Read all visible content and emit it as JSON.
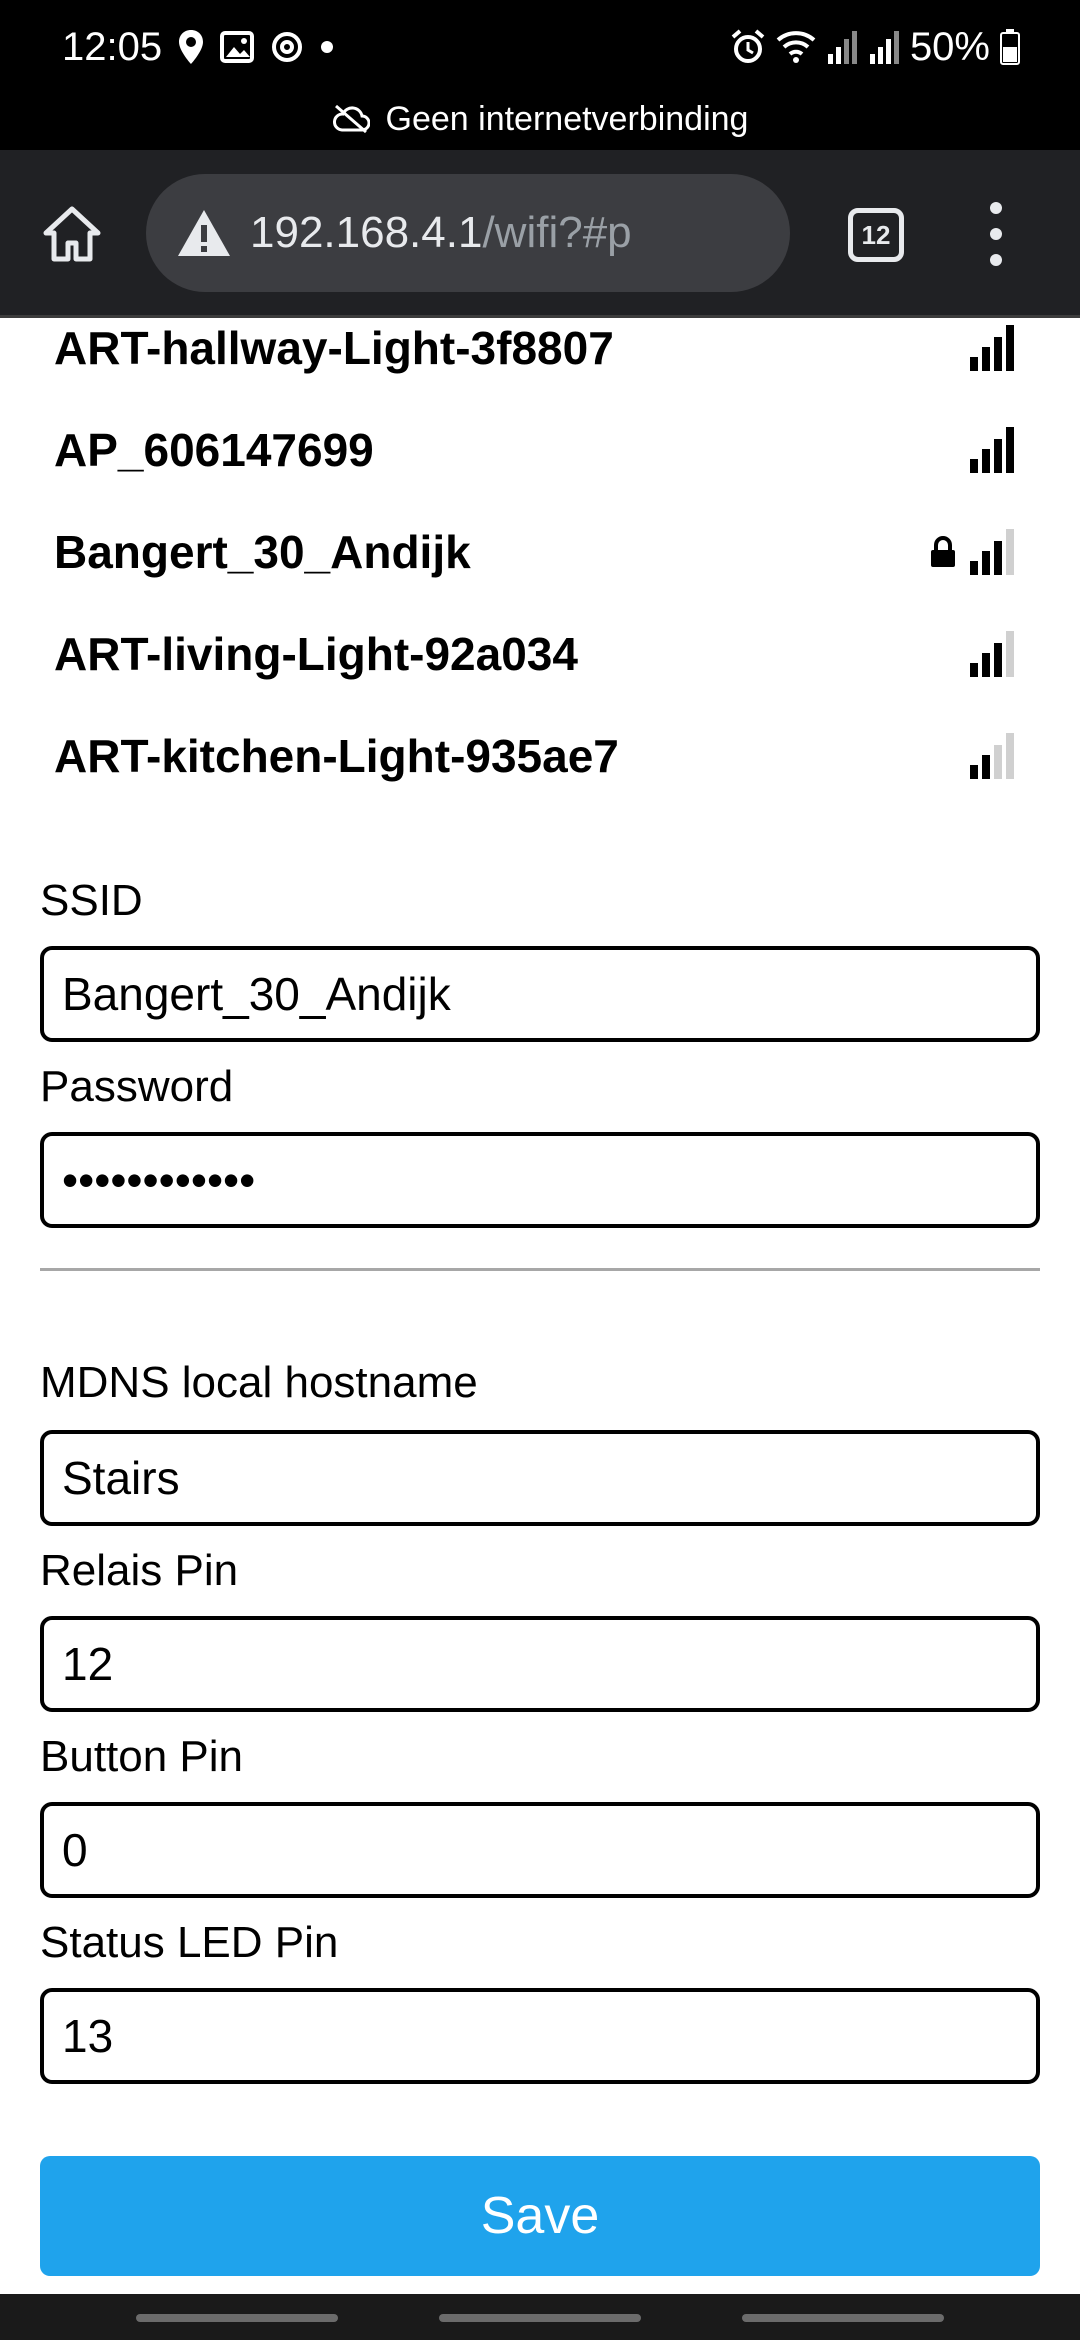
{
  "status_bar": {
    "time": "12:05",
    "battery_text": "50%",
    "no_connection_text": "Geen internetverbinding",
    "left_icons": [
      "location-icon",
      "gallery-icon",
      "sync-icon",
      "dot-icon"
    ],
    "right_icons": [
      "alarm-icon",
      "wifi-icon",
      "signal-icon",
      "signal-icon",
      "battery-icon"
    ]
  },
  "browser": {
    "url_host": "192.168.4.1",
    "url_path": "/wifi?#p",
    "tab_count": "12",
    "icons": [
      "home-icon",
      "warning-icon",
      "tabs-icon",
      "more-vert-icon"
    ]
  },
  "networks": [
    {
      "name": "ART-hallway-Light-3f8807",
      "locked": false,
      "bars": 4
    },
    {
      "name": "AP_606147699",
      "locked": false,
      "bars": 4
    },
    {
      "name": "Bangert_30_Andijk",
      "locked": true,
      "bars": 3
    },
    {
      "name": "ART-living-Light-92a034",
      "locked": false,
      "bars": 3
    },
    {
      "name": "ART-kitchen-Light-935ae7",
      "locked": false,
      "bars": 2
    }
  ],
  "form": {
    "ssid_label": "SSID",
    "ssid_value": "Bangert_30_Andijk",
    "password_label": "Password",
    "password_value": "••••••••••••",
    "mdns_label": "MDNS local hostname",
    "mdns_value": "Stairs",
    "relais_label": "Relais Pin",
    "relais_value": "12",
    "button_label": "Button Pin",
    "button_value": "0",
    "status_led_label": "Status LED Pin",
    "status_led_value": "13",
    "save_label": "Save"
  },
  "colors": {
    "save_button": "#1fa3ec",
    "toolbar": "#202124",
    "url_box": "#3c3d41",
    "signal_on": "#000000",
    "signal_off": "#d0d0d0"
  }
}
